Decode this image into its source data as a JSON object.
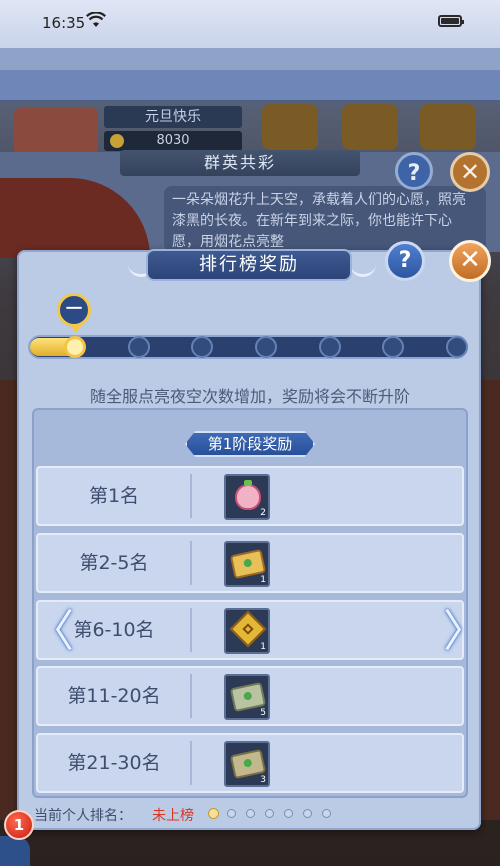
{
  "status_bar": {
    "time": "16:35"
  },
  "background_game": {
    "player_name": "元旦快乐",
    "score": "8030",
    "panel_title": "群英共彩",
    "panel_description": "一朵朵烟花升上天空，承载着人们的心愿，照亮漆黑的长夜。在新年到来之际，你也能许下心愿，用烟花点亮整",
    "help_label": "?",
    "close_label": "✕"
  },
  "dialog": {
    "title": "排行榜奖励",
    "help_label": "?",
    "close_label": "✕",
    "current_stage_label": "一",
    "progress": {
      "total_nodes": 7,
      "current_node": 1
    },
    "hint": "随全服点亮夜空次数增加，奖励将会不断升阶",
    "stage_tag": "第1阶段奖励",
    "rows": [
      {
        "rank": "第1名",
        "item": "pink-pouch-icon",
        "count": "2"
      },
      {
        "rank": "第2-5名",
        "item": "gold-scroll-icon",
        "count": "1"
      },
      {
        "rank": "第6-10名",
        "item": "gold-tile-icon",
        "count": "1"
      },
      {
        "rank": "第11-20名",
        "item": "silver-scroll-icon",
        "count": "5"
      },
      {
        "rank": "第21-30名",
        "item": "bronze-scroll-icon",
        "count": "3"
      }
    ],
    "prev_arrow": "〈",
    "next_arrow": "〉",
    "footer": {
      "label": "当前个人排名：",
      "value": "未上榜",
      "page_count": 7,
      "current_page": 1
    }
  },
  "notification_badge": "1",
  "colors": {
    "accent_blue": "#2c4478",
    "accent_gold": "#f3c542",
    "close_orange": "#c26d25",
    "unranked_red": "#d8371f"
  }
}
